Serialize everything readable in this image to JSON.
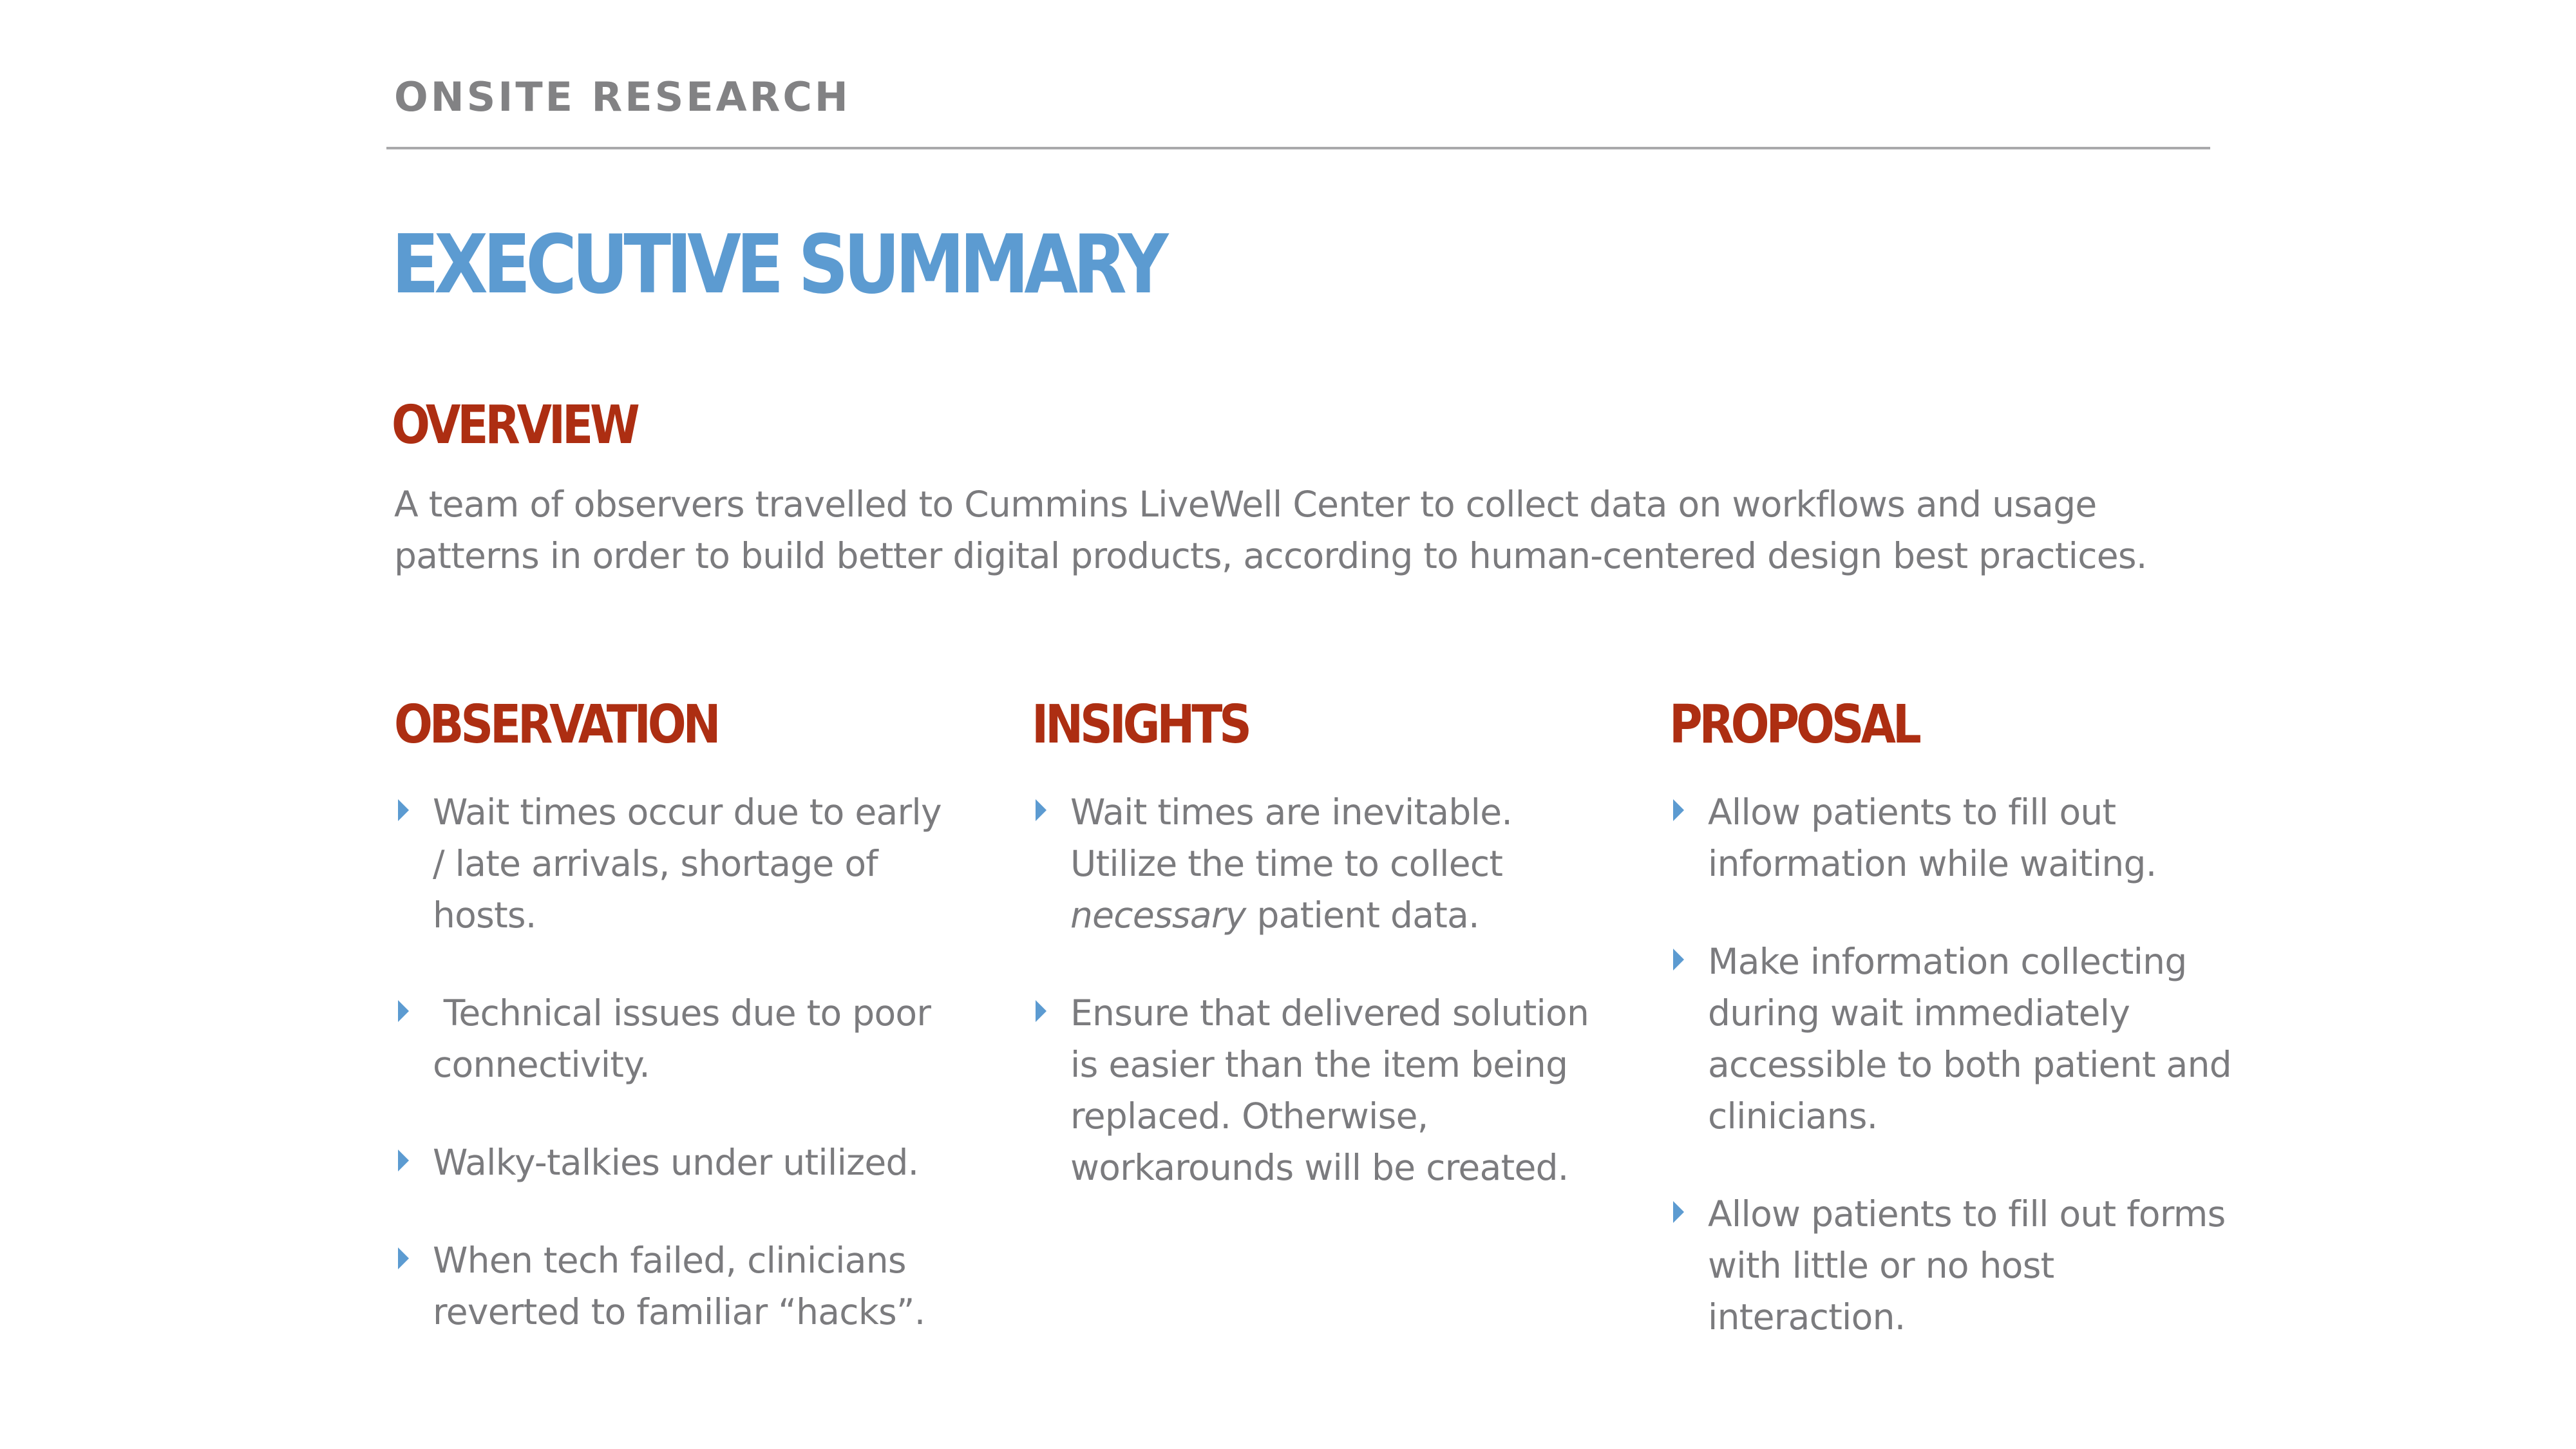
{
  "header": {
    "kicker": "ONSITE RESEARCH",
    "title": "EXECUTIVE SUMMARY"
  },
  "overview": {
    "heading": "OVERVIEW",
    "text": "A team of observers travelled to Cummins LiveWell Center to collect data on workflows and usage patterns in order to build better digital products, according to human-centered design best practices."
  },
  "columns": {
    "observation": {
      "heading": "OBSERVATION",
      "items": [
        "Wait times occur due to early / late arrivals, shortage of hosts.",
        " Technical issues due to poor connectivity.",
        "Walky-talkies under utilized.",
        "When tech failed, clinicians reverted to familiar “hacks”."
      ]
    },
    "insights": {
      "heading": "INSIGHTS",
      "item1_before": "Wait times are inevitable. Utilize the time to collect ",
      "item1_italic": "necessary",
      "item1_after": " patient data.",
      "item2": "Ensure that delivered solution is easier than the item being replaced. Otherwise, workarounds will be created."
    },
    "proposal": {
      "heading": "PROPOSAL",
      "items": [
        "Allow patients to fill out information while waiting.",
        "Make information collecting during wait immediately accessible to both patient and clinicians.",
        "Allow patients to fill out forms with little or no host interaction."
      ]
    }
  },
  "colors": {
    "title": "#5c9bd1",
    "heading": "#ad2e12",
    "body": "#7b7b7e",
    "bullet": "#5c9bd1",
    "rule": "#a9a9ab"
  },
  "icons": {
    "bullet": "triangle-bullet-icon"
  }
}
